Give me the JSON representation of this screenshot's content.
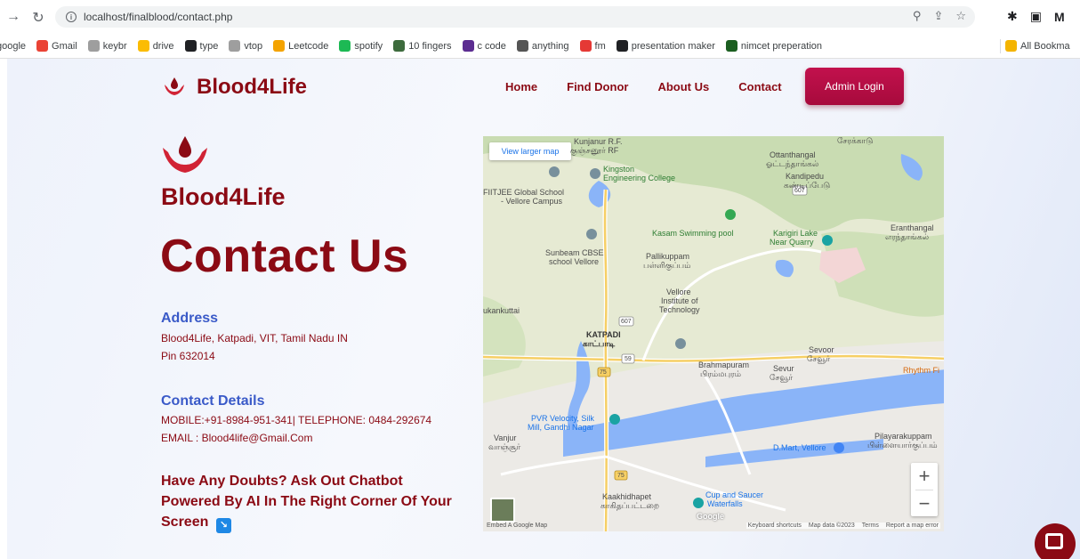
{
  "browser": {
    "url": "localhost/finalblood/contact.php",
    "bookmarks": [
      "google",
      "Gmail",
      "keybr",
      "drive",
      "type",
      "vtop",
      "Leetcode",
      "spotify",
      "10 fingers",
      "c code",
      "anything",
      "fm",
      "presentation maker",
      "nimcet preperation"
    ],
    "bookmark_colors": [
      "#ffffff",
      "#ea4335",
      "#9e9e9e",
      "#fbbc04",
      "#202124",
      "#9e9e9e",
      "#f4a300",
      "#1db954",
      "#3d6b3d",
      "#5c2d91",
      "#555555",
      "#e53935",
      "#202124",
      "#1b5e20"
    ],
    "all_bookmarks": "All Bookma"
  },
  "nav": {
    "brand": "Blood4Life",
    "items": [
      "Home",
      "Find Donor",
      "About Us",
      "Contact"
    ],
    "admin_button": "Admin Login"
  },
  "hero": {
    "brand": "Blood4Life",
    "title": "Contact Us"
  },
  "address": {
    "heading": "Address",
    "line1": "Blood4Life, Katpadi, VIT, Tamil Nadu IN",
    "line2": "Pin 632014"
  },
  "contact": {
    "heading": "Contact Details",
    "line1": "MOBILE:+91-8984-951-341| TELEPHONE: 0484-292674",
    "line2": "EMAIL : Blood4life@Gmail.Com"
  },
  "doubts": {
    "text": "Have Any Doubts? Ask Out Chatbot Powered By AI In The Right Corner Of Your Screen"
  },
  "map": {
    "view_larger": "View larger map",
    "zoom_in": "+",
    "zoom_out": "−",
    "google": "Google",
    "footer_left": "Embed A Google Map",
    "footer_right": [
      "Keyboard shortcuts",
      "Map data ©2023",
      "Terms",
      "Report a map error"
    ],
    "labels": {
      "kunjanur": "Kunjanur R.F.",
      "kunjanur_ta": "குஞ்சனூர் RF",
      "serakadu": "சேரக்காடு",
      "ottanthangal": "Ottanthangal",
      "ottanthangal_ta": "ஓட்டந்தாங்கல்",
      "kandipedu": "Kandipedu",
      "kandipedu_ta": "கண்டிப்பேடு",
      "kingston": "Kingston",
      "kingston2": "Engineering College",
      "fiitjee": "FIITJEE Global School",
      "fiitjee2": "- Vellore Campus",
      "kasam": "Kasam Swimming pool",
      "karigiri": "Karigiri Lake",
      "karigiri2": "Near Quarry",
      "eranthangal": "Eranthangal",
      "eranthangal_ta": "எரந்தாங்கல்",
      "sunbeam": "Sunbeam CBSE",
      "sunbeam2": "school Vellore",
      "pallikuppam": "Pallikuppam",
      "pallikuppam_ta": "பள்ளிகுப்பம்",
      "vit": "Vellore",
      "vit2": "Institute of",
      "vit3": "Technology",
      "sukankuttai": "ukankuttai",
      "katpadi": "KATPADI",
      "katpadi_ta": "காட்பாடி",
      "sevoor": "Sevoor",
      "sevoor_ta": "சேவூர்",
      "brahmapuram": "Brahmapuram",
      "brahmapuram_ta": "பிரம்மபுரம்",
      "sevur": "Sevur",
      "sevur_ta": "சேவூர்",
      "rhythm": "Rhythm Fi",
      "pvr": "PVR Velocity, Silk",
      "pvr2": "Mill, Gandhi Nagar",
      "vanjur": "Vanjur",
      "vanjur_ta": "வாஞ்சூர்",
      "dmart": "D.Mart, Vellore",
      "pilayar": "Pilayarakuppam",
      "pilayar_ta": "பிள்ளையார்குப்பம்",
      "kaakhid": "Kaakhidhapet",
      "kaakhid_ta": "காகிதப்பட்டறை",
      "cup": "Cup and Saucer",
      "cup2": "Waterfalls",
      "r75": "75",
      "r607": "607",
      "r59": "59"
    }
  }
}
